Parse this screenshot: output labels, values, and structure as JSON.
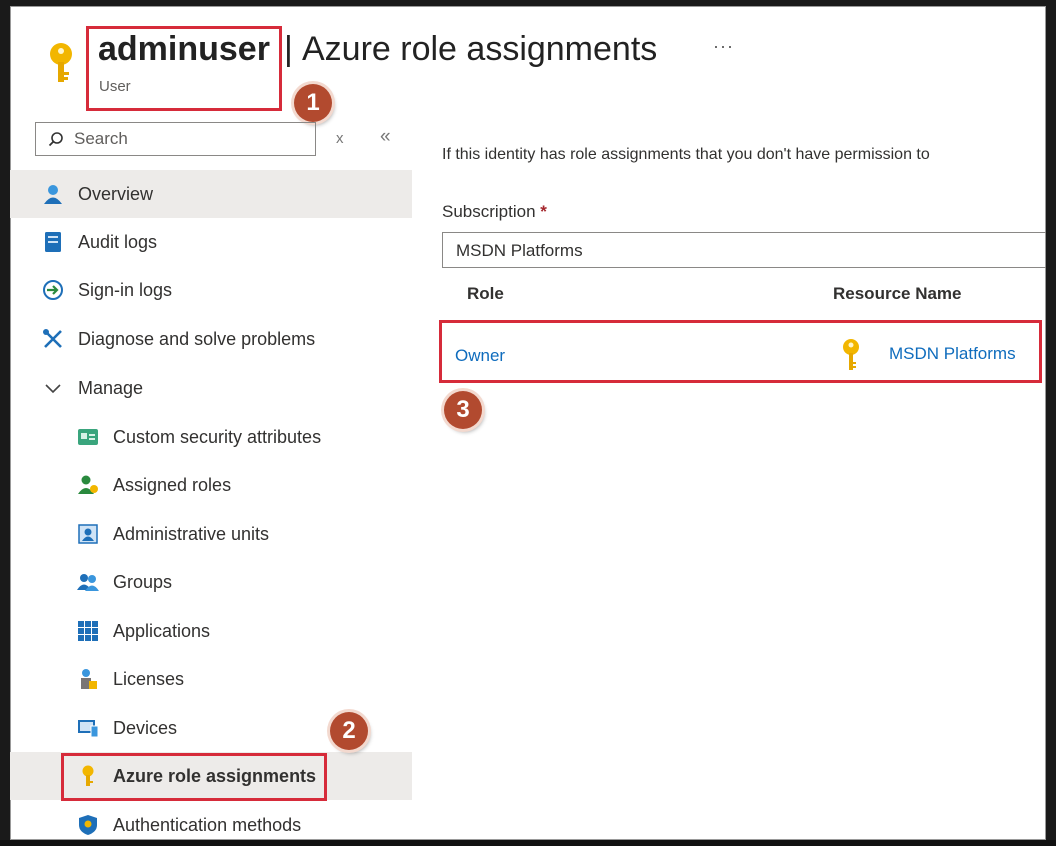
{
  "header": {
    "user_name": "adminuser",
    "separator": "|",
    "page_title": "Azure role assignments",
    "more_label": "···",
    "user_type": "User"
  },
  "badges": [
    "1",
    "2",
    "3"
  ],
  "search": {
    "placeholder": "Search",
    "pin_glyph": "x",
    "collapse_glyph": "«"
  },
  "sidebar": {
    "items": [
      {
        "label": "Overview",
        "icon": "user-icon"
      },
      {
        "label": "Audit logs",
        "icon": "audit-log-icon"
      },
      {
        "label": "Sign-in logs",
        "icon": "sign-in-icon"
      },
      {
        "label": "Diagnose and solve problems",
        "icon": "wrench-icon"
      },
      {
        "label": "Manage",
        "icon": "chevron-down-icon"
      },
      {
        "label": "Custom security attributes",
        "icon": "security-attributes-icon"
      },
      {
        "label": "Assigned roles",
        "icon": "assigned-roles-icon"
      },
      {
        "label": "Administrative units",
        "icon": "admin-units-icon"
      },
      {
        "label": "Groups",
        "icon": "groups-icon"
      },
      {
        "label": "Applications",
        "icon": "grid-icon"
      },
      {
        "label": "Licenses",
        "icon": "licenses-icon"
      },
      {
        "label": "Devices",
        "icon": "devices-icon"
      },
      {
        "label": "Azure role assignments",
        "icon": "key-icon"
      },
      {
        "label": "Authentication methods",
        "icon": "shield-icon"
      }
    ]
  },
  "main": {
    "info_text": "If this identity has role assignments that you don't have permission to",
    "subscription_label": "Subscription",
    "required_mark": "*",
    "subscription_value": "MSDN Platforms",
    "table": {
      "headers": [
        "Role",
        "Resource Name"
      ],
      "rows": [
        {
          "role": "Owner",
          "resource": "MSDN Platforms"
        }
      ]
    }
  },
  "colors": {
    "accent": "#0f6cbd",
    "highlight": "#d62b3a",
    "badge": "#b24a2f",
    "key": "#f2b600"
  }
}
